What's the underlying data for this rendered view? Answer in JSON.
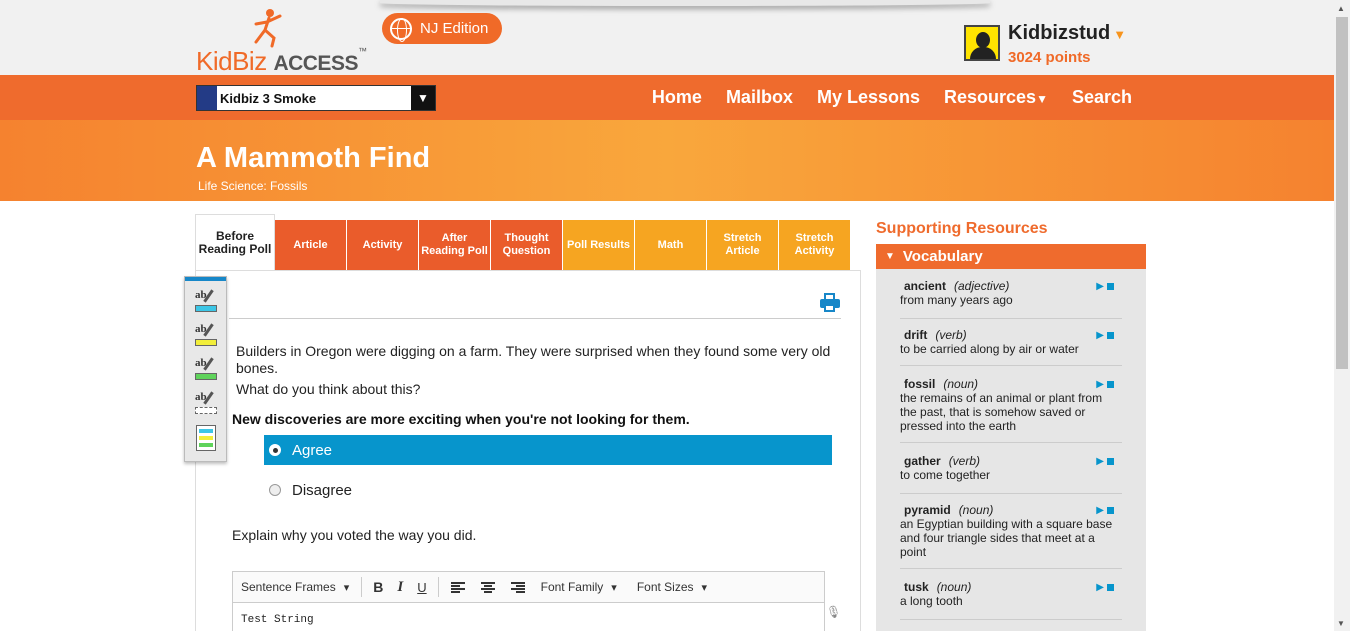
{
  "brand": {
    "kid": "Kid",
    "biz": "Biz",
    "access": "ACCESS",
    "tm": "™"
  },
  "edition": "NJ Edition",
  "user": {
    "name": "Kidbizstud",
    "points": "3024 points"
  },
  "class_select": "Kidbiz 3 Smoke",
  "nav": [
    "Home",
    "Mailbox",
    "My Lessons",
    "Resources",
    "Search"
  ],
  "lesson": {
    "title": "A Mammoth Find",
    "subtitle": "Life Science: Fossils"
  },
  "tabs": [
    "Before Reading Poll",
    "Article",
    "Activity",
    "After Reading Poll",
    "Thought Question",
    "Poll Results",
    "Math",
    "Stretch Article",
    "Stretch Activity"
  ],
  "poll": {
    "prompt1": "Builders in Oregon were digging on a farm. They were surprised when they found some very old bones.",
    "prompt2": "What do you think about this?",
    "question": "New discoveries are more exciting when you're not looking for them.",
    "options": [
      "Agree",
      "Disagree"
    ],
    "selected": "Agree",
    "explain": "Explain why you voted the way you did."
  },
  "editor": {
    "sentence_frames": "Sentence Frames",
    "bold": "B",
    "italic": "I",
    "underline": "U",
    "font_family": "Font Family",
    "font_sizes": "Font Sizes",
    "text": "Test String"
  },
  "highlighter_tool_colors": [
    "#3cc6e6",
    "#f2ee3a",
    "#5fd35b",
    "#ffffff"
  ],
  "supporting_resources": "Supporting Resources",
  "vocabulary": {
    "heading": "Vocabulary",
    "entries": [
      {
        "word": "ancient",
        "pos": "(adjective)",
        "def": "from many years ago"
      },
      {
        "word": "drift",
        "pos": "(verb)",
        "def": "to be carried along by air or water"
      },
      {
        "word": "fossil",
        "pos": "(noun)",
        "def": "the remains of an animal or plant from the past, that is somehow saved or pressed into the earth"
      },
      {
        "word": "gather",
        "pos": "(verb)",
        "def": "to come together"
      },
      {
        "word": "pyramid",
        "pos": "(noun)",
        "def": "an Egyptian building with a square base and four triangle sides that meet at a point"
      },
      {
        "word": "tusk",
        "pos": "(noun)",
        "def": "a long tooth"
      }
    ]
  },
  "colors": {
    "brand_orange": "#ef6b2d",
    "light_orange": "#f6a521",
    "selected_blue": "#0795cc"
  }
}
